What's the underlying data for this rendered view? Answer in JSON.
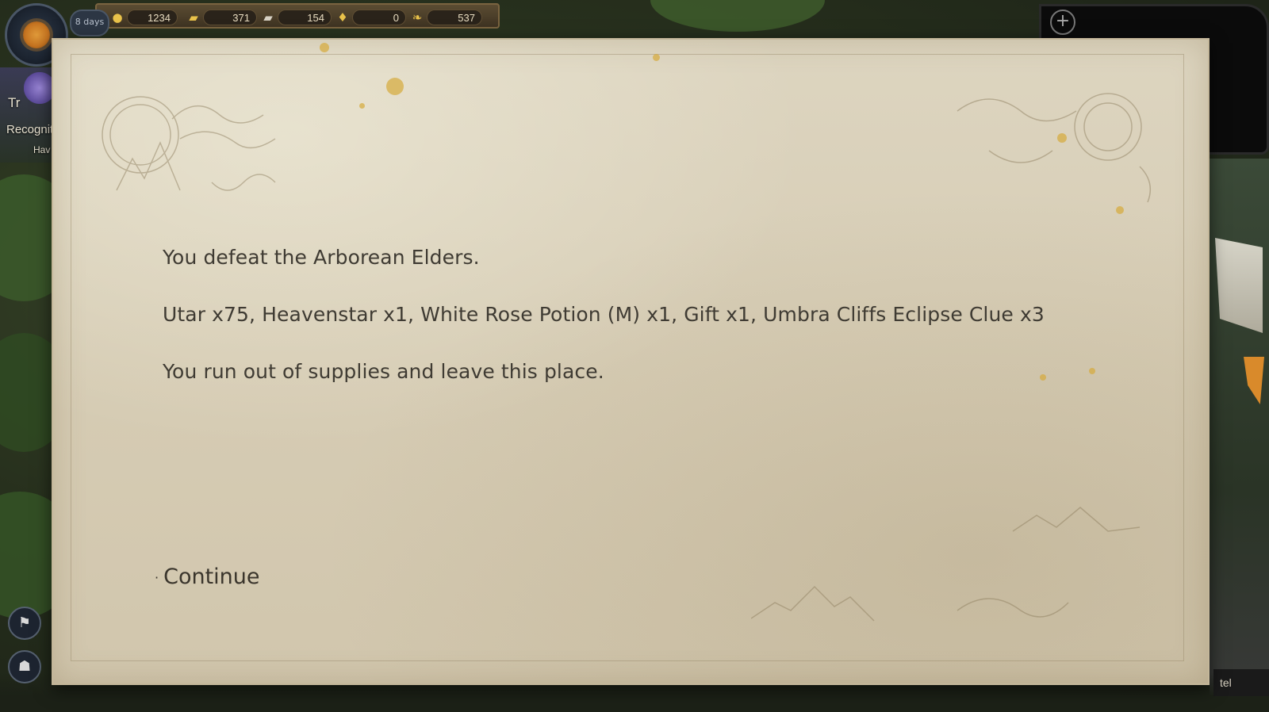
{
  "hud": {
    "day_counter": "8 days",
    "resources": [
      {
        "icon": "gold-coin-icon",
        "value": "1234"
      },
      {
        "icon": "gold-bars-icon",
        "value": "371"
      },
      {
        "icon": "silver-ingot-icon",
        "value": "154"
      },
      {
        "icon": "crystal-drop-icon",
        "value": "0"
      },
      {
        "icon": "horn-icon",
        "value": "537"
      }
    ]
  },
  "background": {
    "left_text_1": "Tr",
    "left_text_2": "Recogniti",
    "left_text_3": "Hav",
    "right_bottom_label": "tel"
  },
  "dialog": {
    "lines": [
      "You defeat the Arborean Elders.",
      "Utar x75, Heavenstar x1, White Rose Potion (M) x1, Gift x1, Umbra Cliffs Eclipse Clue x3",
      "You run out of supplies and leave this place."
    ],
    "option_continue": "Continue"
  },
  "colors": {
    "parchment": "#d8cfb8",
    "text": "#3f3b33",
    "gold": "#d6a93a"
  }
}
